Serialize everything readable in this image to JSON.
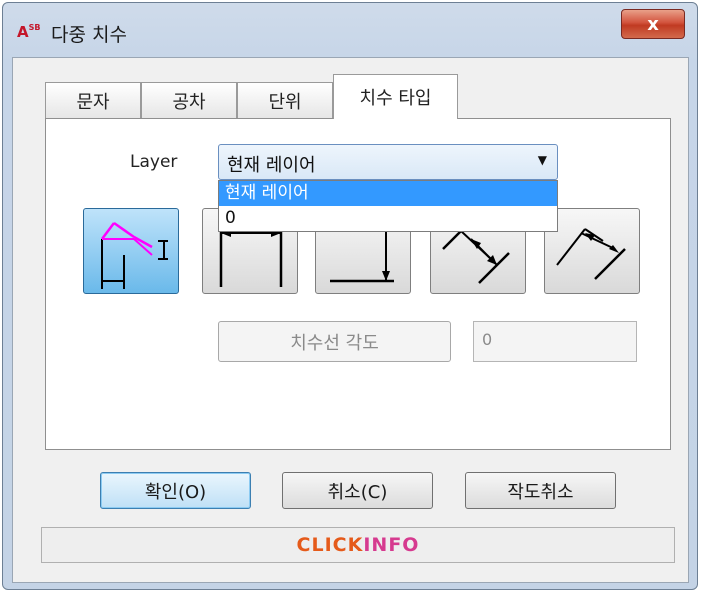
{
  "window": {
    "title": "다중 치수",
    "icon_label": "A",
    "icon_sub": "SB",
    "close_symbol": "x"
  },
  "tabs": [
    {
      "label": "문자",
      "active": false
    },
    {
      "label": "공차",
      "active": false
    },
    {
      "label": "단위",
      "active": false
    },
    {
      "label": "치수 타입",
      "active": true
    }
  ],
  "layer": {
    "label": "Layer",
    "selected": "현재 레이어",
    "arrow": "▼",
    "options": [
      "현재 레이어",
      "0"
    ]
  },
  "dimension_types": [
    {
      "name": "multi-dim-icon",
      "selected": true
    },
    {
      "name": "horizontal-dim-icon",
      "selected": false
    },
    {
      "name": "vertical-dim-icon",
      "selected": false
    },
    {
      "name": "aligned-dim-icon",
      "selected": false
    },
    {
      "name": "rotated-dim-icon",
      "selected": false
    }
  ],
  "angle": {
    "button_label": "치수선 각도",
    "value": "0"
  },
  "buttons": {
    "ok": "확인(O)",
    "cancel": "취소(C)",
    "cancel_drawing": "작도취소"
  },
  "footer": {
    "brand_part1": "CLICK",
    "brand_part2": "INFO"
  },
  "colors": {
    "accent": "#3399ff",
    "brand_orange": "#e55a1a",
    "brand_pink": "#d63a8f",
    "icon_magenta": "#ff00ff"
  }
}
